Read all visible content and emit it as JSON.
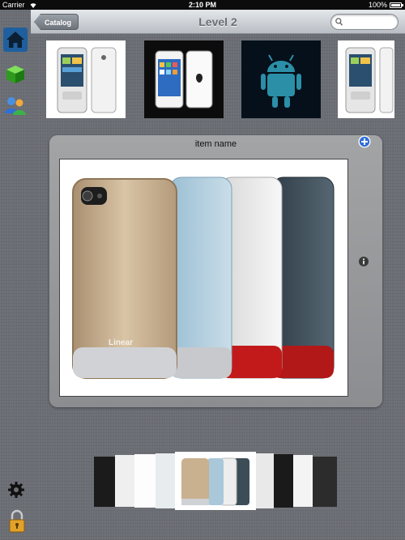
{
  "status_bar": {
    "carrier": "Carrier",
    "time": "2:10 PM",
    "battery": "100%"
  },
  "sidebar": {
    "items": [
      {
        "name": "home",
        "icon": "home-icon",
        "active": true
      },
      {
        "name": "catalog",
        "icon": "green-cube-icon"
      },
      {
        "name": "users",
        "icon": "users-icon"
      }
    ],
    "bottom": [
      {
        "name": "settings",
        "icon": "gear-icon"
      },
      {
        "name": "lock",
        "icon": "padlock-icon"
      }
    ]
  },
  "navbar": {
    "back_label": "Catalog",
    "title": "Level 2",
    "search_placeholder": ""
  },
  "thumbnails": [
    {
      "name": "htc-white-phone",
      "icon": "phone-thumbnail"
    },
    {
      "name": "iphone-4-black-white",
      "icon": "phone-thumbnail"
    },
    {
      "name": "android-robot",
      "icon": "android-icon"
    },
    {
      "name": "htc-white-phone-2",
      "icon": "phone-thumbnail"
    }
  ],
  "detail": {
    "item_name": "item name",
    "case_brand": "Linear"
  },
  "coverflow": {
    "count": 9,
    "selected_index": 4
  },
  "colors": {
    "background": "#6b6e74",
    "panel": "#999a9c",
    "navbar": "#c8ccd1",
    "accent_blue": "#2f6fd6"
  }
}
